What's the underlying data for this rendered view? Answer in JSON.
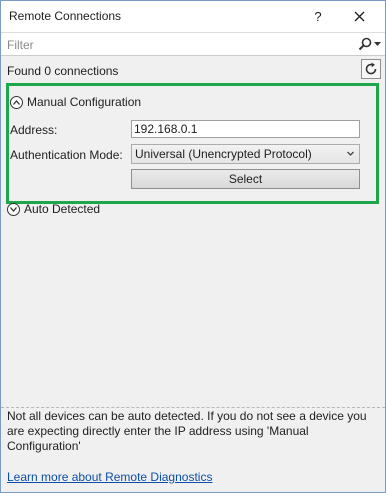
{
  "window": {
    "title": "Remote Connections",
    "help_label": "?",
    "close_icon": "close-icon"
  },
  "filter": {
    "placeholder": "Filter",
    "search_icon": "search-icon"
  },
  "status": {
    "found_text": "Found 0 connections",
    "refresh_icon": "refresh-icon"
  },
  "manual": {
    "header": "Manual Configuration",
    "expanded": true,
    "address_label": "Address:",
    "address_value": "192.168.0.1",
    "auth_label": "Authentication Mode:",
    "auth_value": "Universal (Unencrypted Protocol)",
    "select_label": "Select"
  },
  "auto": {
    "header": "Auto Detected",
    "expanded": false
  },
  "footer": {
    "info_text": "Not all devices can be auto detected. If you do not see a device you are expecting directly enter the IP address using 'Manual Configuration'",
    "learn_link": "Learn more about Remote Diagnostics"
  },
  "colors": {
    "highlight": "#1ea64a",
    "link": "#0e4ea8",
    "window_border": "#7a9bc5"
  }
}
